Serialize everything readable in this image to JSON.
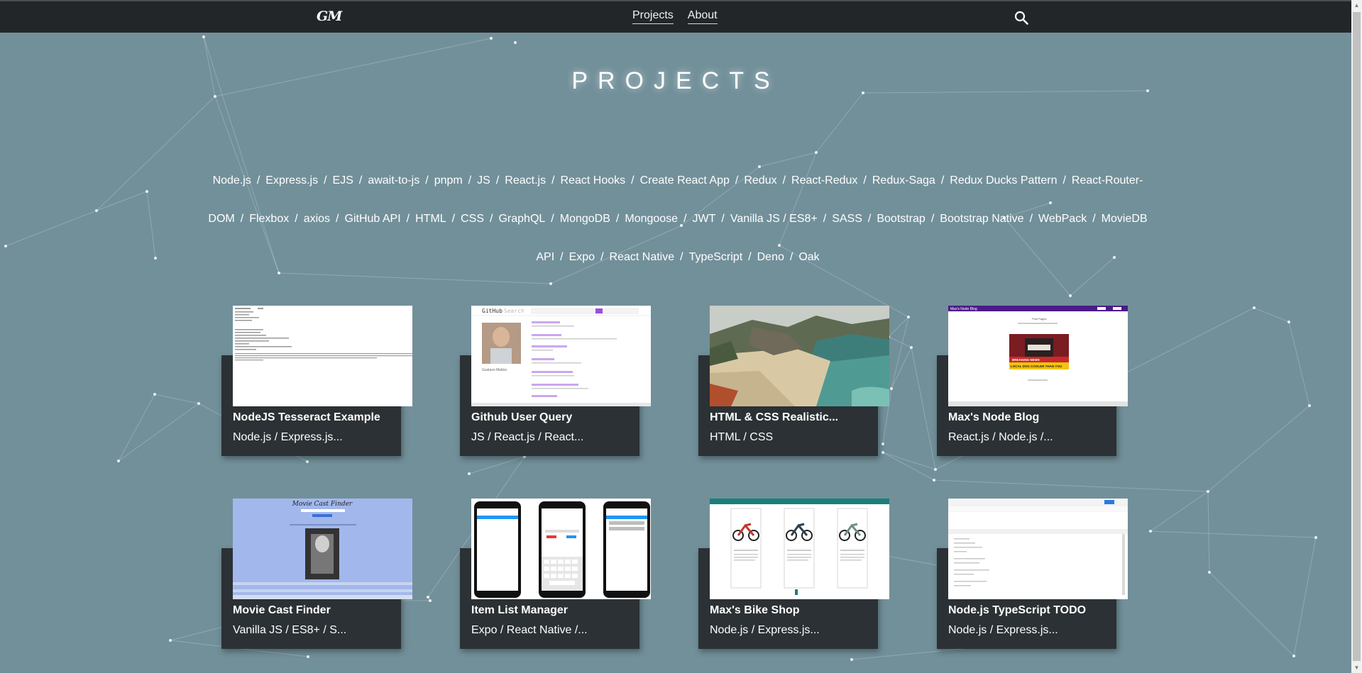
{
  "nav": {
    "logo": "GM",
    "links": [
      "Projects",
      "About"
    ]
  },
  "page_title": "PROJECTS",
  "technologies": [
    "Node.js",
    "Express.js",
    "EJS",
    "await-to-js",
    "pnpm",
    "JS",
    "React.js",
    "React Hooks",
    "Create React App",
    "Redux",
    "React-Redux",
    "Redux-Saga",
    "Redux Ducks Pattern",
    "React-Router-DOM",
    "Flexbox",
    "axios",
    "GitHub API",
    "HTML",
    "CSS",
    "GraphQL",
    "MongoDB",
    "Mongoose",
    "JWT",
    "Vanilla JS / ES8+",
    "SASS",
    "Bootstrap",
    "Bootstrap Native",
    "WebPack",
    "MovieDB API",
    "Expo",
    "React Native",
    "TypeScript",
    "Deno",
    "Oak"
  ],
  "projects": [
    {
      "title": "NodeJS Tesseract Example",
      "tags": "Node.js / Express.js..."
    },
    {
      "title": "Github User Query",
      "tags": "JS / React.js / React..."
    },
    {
      "title": "HTML & CSS Realistic...",
      "tags": "HTML / CSS"
    },
    {
      "title": "Max's Node Blog",
      "tags": "React.js / Node.js /..."
    },
    {
      "title": "Movie Cast Finder",
      "tags": "Vanilla JS / ES8+ / S..."
    },
    {
      "title": "Item List Manager",
      "tags": "Expo / React Native /..."
    },
    {
      "title": "Max's Bike Shop",
      "tags": "Node.js / Express.js..."
    },
    {
      "title": "Node.js TypeScript TODO",
      "tags": "Node.js / Express.js..."
    }
  ],
  "thumbnails": {
    "github": {
      "brand": "GitHub",
      "search": "Search",
      "name": "Gustavo Mattos"
    },
    "blog": {
      "brand": "Max's Node Blog",
      "heading": "Post Pages",
      "banner_top": "BREAKING NEWS",
      "banner_bottom": "LOCAL DOG COOLER THAN YOU"
    },
    "movie": {
      "brand": "Movie Cast Finder"
    }
  },
  "colors": {
    "background": "#72909a",
    "navbar": "#222628",
    "card_panel": "#2b3134"
  }
}
